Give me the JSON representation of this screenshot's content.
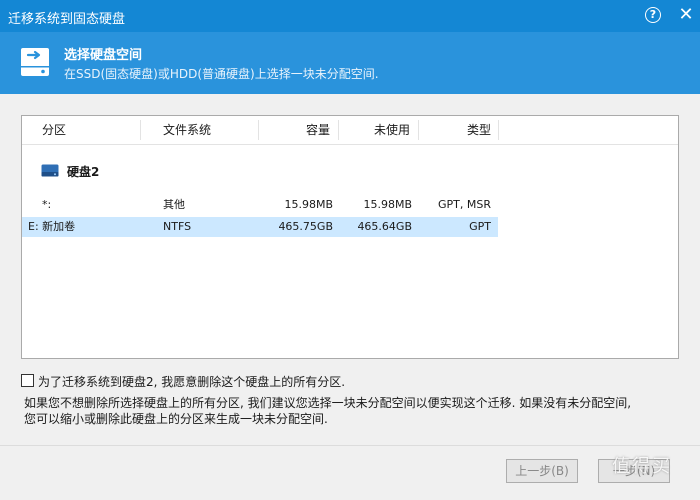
{
  "window": {
    "title": "迁移系统到固态硬盘",
    "help": "?",
    "close": "✕"
  },
  "header": {
    "title": "选择硬盘空间",
    "subtitle": "在SSD(固态硬盘)或HDD(普通硬盘)上选择一块未分配空间."
  },
  "table": {
    "columns": [
      "分区",
      "文件系统",
      "容量",
      "未使用",
      "类型"
    ],
    "disk": {
      "label": "硬盘2"
    },
    "rows": [
      {
        "partition": "*:",
        "filesystem": "其他",
        "capacity": "15.98MB",
        "unused": "15.98MB",
        "type": "GPT, MSR",
        "selected": false
      },
      {
        "partition": "E: 新加卷",
        "filesystem": "NTFS",
        "capacity": "465.75GB",
        "unused": "465.64GB",
        "type": "GPT",
        "selected": true
      }
    ]
  },
  "checkbox": {
    "label": "为了迁移系统到硬盘2, 我愿意删除这个硬盘上的所有分区.",
    "checked": false
  },
  "note": {
    "line1": "如果您不想删除所选择硬盘上的所有分区, 我们建议您选择一块未分配空间以便实现这个迁移. 如果没有未分配空间,",
    "line2": "您可以缩小或删除此硬盘上的分区来生成一块未分配空间."
  },
  "buttons": {
    "prev": "上一步(B)",
    "next": "一步(N)"
  },
  "watermark": "值得买",
  "colors": {
    "titlebar": "#1487d4",
    "header": "#2a93dc",
    "selected_row": "#cce8ff"
  }
}
